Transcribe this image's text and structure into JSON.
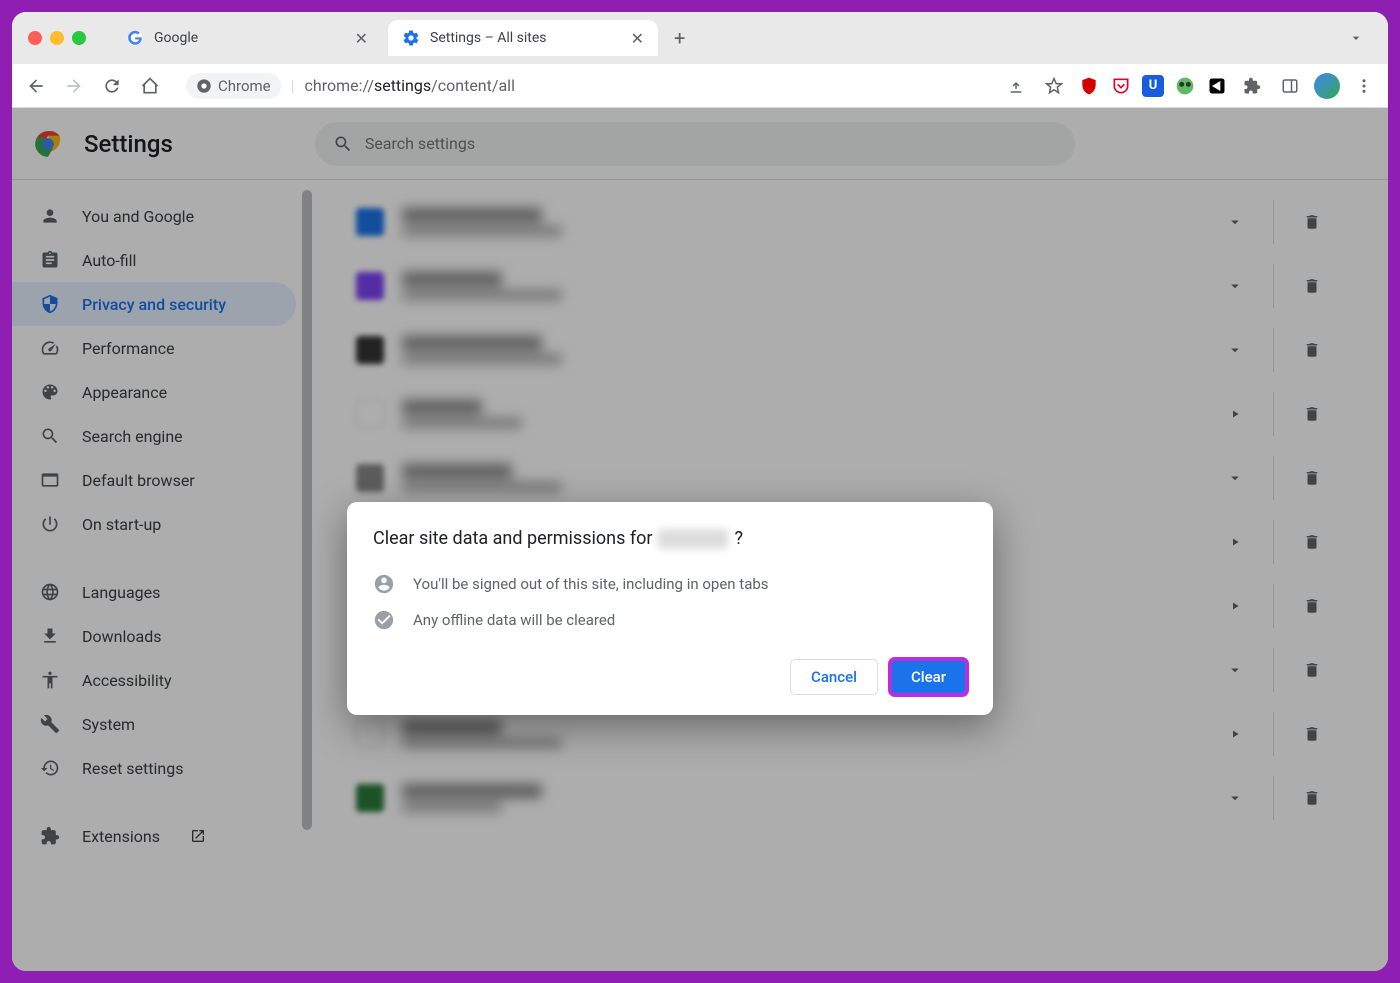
{
  "tabs": [
    {
      "title": "Google"
    },
    {
      "title": "Settings – All sites"
    }
  ],
  "omnibox": {
    "chip": "Chrome",
    "url_prefix": "chrome://",
    "url_bold": "settings",
    "url_suffix": "/content/all"
  },
  "settings": {
    "title": "Settings",
    "search_placeholder": "Search settings"
  },
  "nav": {
    "you": "You and Google",
    "autofill": "Auto-fill",
    "privacy": "Privacy and security",
    "performance": "Performance",
    "appearance": "Appearance",
    "search": "Search engine",
    "default_browser": "Default browser",
    "startup": "On start-up",
    "languages": "Languages",
    "downloads": "Downloads",
    "accessibility": "Accessibility",
    "system": "System",
    "reset": "Reset settings",
    "extensions": "Extensions"
  },
  "dialog": {
    "title_prefix": "Clear site data and permissions for ",
    "title_suffix": "?",
    "line1": "You'll be signed out of this site, including in open tabs",
    "line2": "Any offline data will be cleared",
    "cancel": "Cancel",
    "clear": "Clear"
  }
}
